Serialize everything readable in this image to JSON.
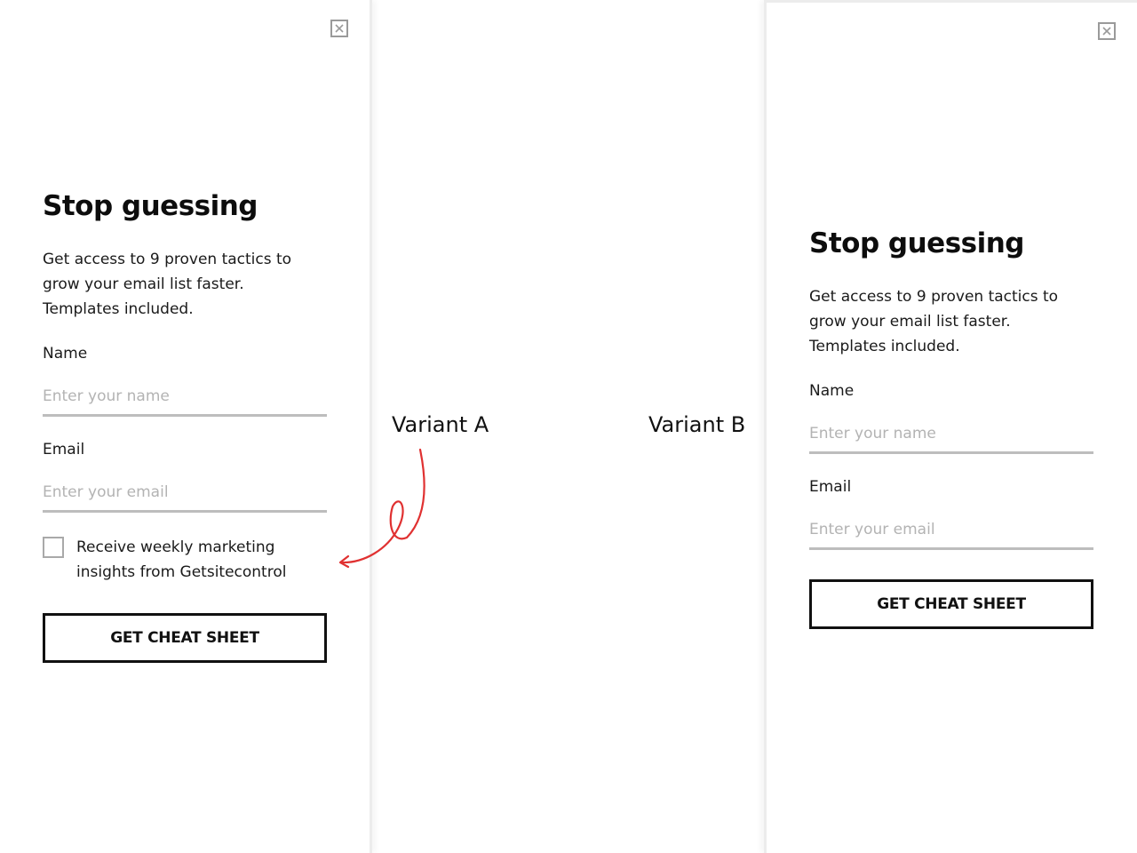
{
  "variant_a": {
    "close_label": "×",
    "title": "Stop guessing",
    "description_lines": [
      "Get access to 9 proven tactics to",
      "grow your email list faster.",
      "Templates included."
    ],
    "name_label": "Name",
    "name_placeholder": "Enter your name",
    "email_label": "Email",
    "email_placeholder": "Enter your email",
    "checkbox_lines": [
      "Receive weekly marketing",
      "insights from Getsitecontrol"
    ],
    "checkbox_checked": false,
    "cta_label": "GET CHEAT SHEET"
  },
  "variant_b": {
    "close_label": "×",
    "title": "Stop guessing",
    "description_lines": [
      "Get access to 9 proven tactics to",
      "grow your email list faster.",
      "Templates included."
    ],
    "name_label": "Name",
    "name_placeholder": "Enter your name",
    "email_label": "Email",
    "email_placeholder": "Enter your email",
    "cta_label": "GET CHEAT SHEET"
  },
  "labels": {
    "variant_a": "Variant A",
    "variant_b": "Variant B"
  },
  "colors": {
    "annotation_arrow": "#e03131",
    "button_border": "#111111",
    "input_underline": "#bdbdbd",
    "placeholder": "#b3b3b3"
  },
  "icons": {
    "close": "close-icon",
    "annotation": "curly-arrow-icon"
  }
}
